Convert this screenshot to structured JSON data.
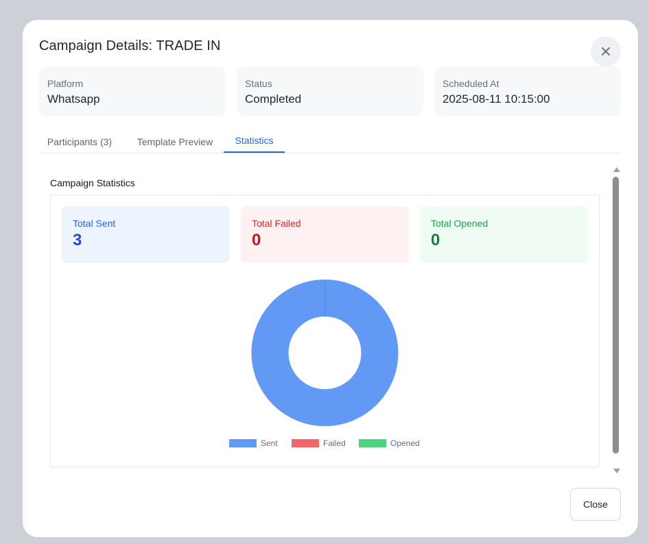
{
  "modal": {
    "title": "Campaign Details: TRADE IN",
    "close_button_label": "Close"
  },
  "info": [
    {
      "label": "Platform",
      "value": "Whatsapp"
    },
    {
      "label": "Status",
      "value": "Completed"
    },
    {
      "label": "Scheduled At",
      "value": "2025-08-11 10:15:00"
    }
  ],
  "tabs": [
    {
      "label": "Participants (3)",
      "active": false
    },
    {
      "label": "Template Preview",
      "active": false
    },
    {
      "label": "Statistics",
      "active": true
    }
  ],
  "statistics": {
    "section_title": "Campaign Statistics",
    "cards": [
      {
        "label": "Total Sent",
        "value": "3",
        "bg": "#eef4fe",
        "fg": "#2563eb",
        "valueColor": "#1d4ed8"
      },
      {
        "label": "Total Failed",
        "value": "0",
        "bg": "#fef1f1",
        "fg": "#dc2626",
        "valueColor": "#b91c1c"
      },
      {
        "label": "Total Opened",
        "value": "0",
        "bg": "#f0fbf4",
        "fg": "#16a34a",
        "valueColor": "#15803d"
      }
    ]
  },
  "chart_data": {
    "type": "pie",
    "variant": "doughnut",
    "categories": [
      "Sent",
      "Failed",
      "Opened"
    ],
    "values": [
      3,
      0,
      0
    ],
    "colors": [
      "#6199f5",
      "#f0676b",
      "#50d283"
    ],
    "legend": "bottom"
  },
  "icons": {
    "close": "close-icon"
  }
}
